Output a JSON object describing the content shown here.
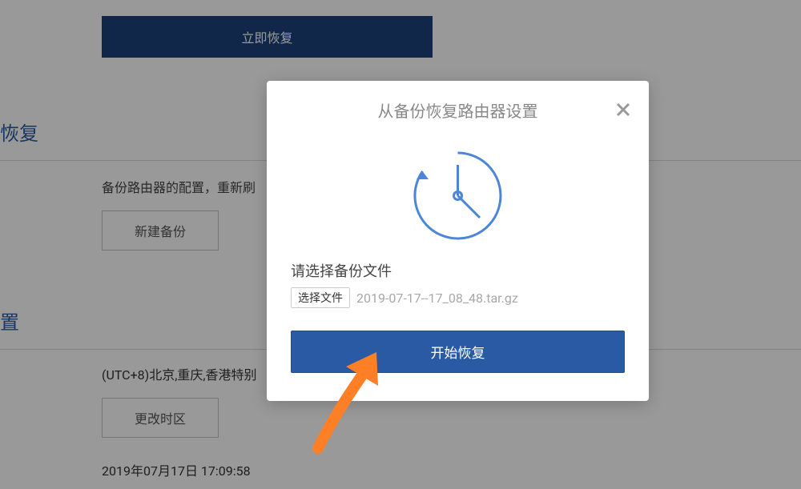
{
  "background": {
    "restore_now_btn": "立即恢复",
    "section1_title": "恢复",
    "section1_desc": "备份路由器的配置，重新刷",
    "new_backup_btn": "新建备份",
    "section2_title": "置",
    "timezone_text": "(UTC+8)北京,重庆,香港特别",
    "change_tz_btn": "更改时区",
    "timestamp_text": "2019年07月17日 17:09:58"
  },
  "modal": {
    "title": "从备份恢复路由器设置",
    "file_label": "请选择备份文件",
    "file_button": "选择文件",
    "file_name": "2019-07-17--17_08_48.tar.gz",
    "start_button": "开始恢复"
  },
  "colors": {
    "primary": "#2a5aa3",
    "accent_arrow": "#ff7f27"
  }
}
